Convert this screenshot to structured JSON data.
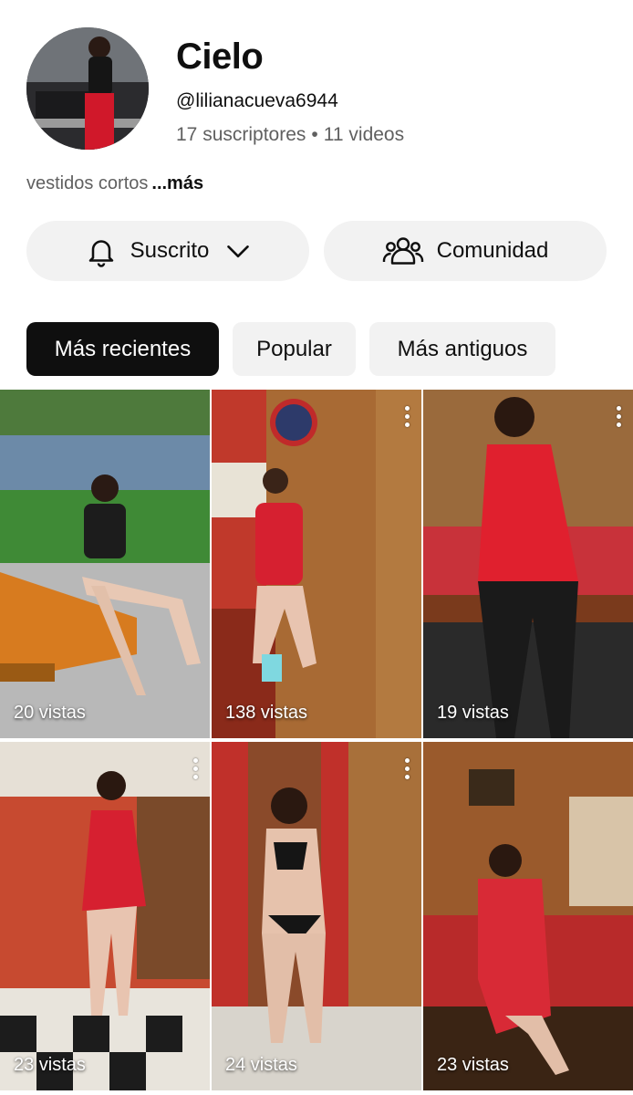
{
  "channel": {
    "name": "Cielo",
    "handle": "@lilianacueva6944",
    "subscribers": "17 suscriptores",
    "separator": "•",
    "videos": "11 videos",
    "description": "vestidos cortos",
    "more_label": "...más",
    "avatar_icon": "channel-avatar"
  },
  "actions": {
    "subscribed_label": "Suscrito",
    "subscribed_icon": "bell-icon",
    "dropdown_icon": "chevron-down-icon",
    "community_label": "Comunidad",
    "community_icon": "people-icon"
  },
  "chips": [
    {
      "label": "Más recientes",
      "active": true
    },
    {
      "label": "Popular",
      "active": false
    },
    {
      "label": "Más antiguos",
      "active": false
    }
  ],
  "videos": [
    {
      "views": "20 vistas",
      "has_menu": false
    },
    {
      "views": "138 vistas",
      "has_menu": true
    },
    {
      "views": "19 vistas",
      "has_menu": true
    },
    {
      "views": "23 vistas",
      "has_menu": true
    },
    {
      "views": "24 vistas",
      "has_menu": true
    },
    {
      "views": "23 vistas",
      "has_menu": false
    }
  ],
  "colors": {
    "active_chip_bg": "#0f0f0f",
    "chip_bg": "#f2f2f2",
    "secondary_text": "#606060"
  }
}
